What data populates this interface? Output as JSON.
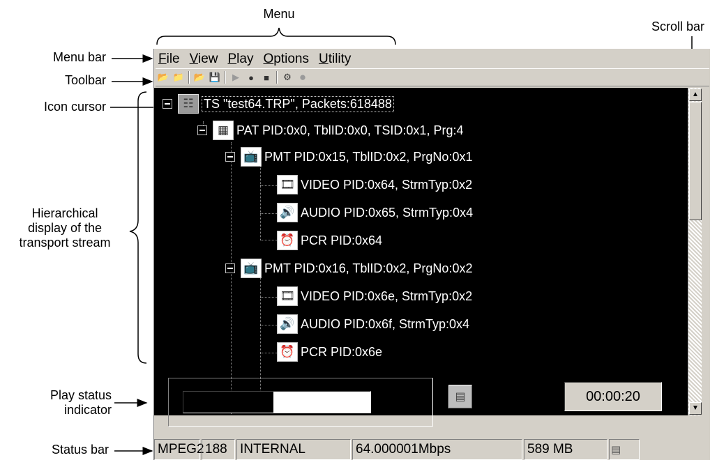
{
  "callouts": {
    "menu": "Menu",
    "scroll_bar": "Scroll bar",
    "menu_bar": "Menu bar",
    "toolbar": "Toolbar",
    "icon_cursor": "Icon cursor",
    "hierarchical_1": "Hierarchical",
    "hierarchical_2": "display of the",
    "hierarchical_3": "transport stream",
    "play_status_1": "Play status",
    "play_status_2": "indicator",
    "status_bar": "Status bar"
  },
  "menu": {
    "file": {
      "accel": "F",
      "rest": "ile"
    },
    "view": {
      "accel": "V",
      "rest": "iew"
    },
    "play": {
      "accel": "P",
      "rest": "lay"
    },
    "options": {
      "accel": "O",
      "rest": "ptions"
    },
    "utility": {
      "accel": "U",
      "rest": "tility"
    }
  },
  "toolbar_icons": [
    "folder-open-icon",
    "folder-icon",
    "open-file-icon",
    "save-icon",
    "play-icon",
    "record-icon",
    "stop-icon",
    "settings-icon",
    "circle-icon"
  ],
  "tree": {
    "ts": "TS \"test64.TRP\", Packets:618488",
    "pat": "PAT PID:0x0, TblID:0x0, TSID:0x1, Prg:4",
    "pmt1": "PMT PID:0x15, TblID:0x2, PrgNo:0x1",
    "video1": "VIDEO PID:0x64, StrmTyp:0x2",
    "audio1": "AUDIO PID:0x65, StrmTyp:0x4",
    "pcr1": "PCR PID:0x64",
    "pmt2": "PMT PID:0x16, TblID:0x2, PrgNo:0x2",
    "video2": "VIDEO PID:0x6e, StrmTyp:0x2",
    "audio2": "AUDIO PID:0x6f, StrmTyp:0x4",
    "pcr2": "PCR PID:0x6e"
  },
  "play_status": {
    "progress_fraction": 0.48,
    "percent_text": "48%",
    "elapsed": "00:00:20"
  },
  "status_bar": {
    "format": "MPEG2",
    "packet_size": "188",
    "clock": "INTERNAL",
    "rate": "64.000001Mbps",
    "size": "589 MB"
  }
}
